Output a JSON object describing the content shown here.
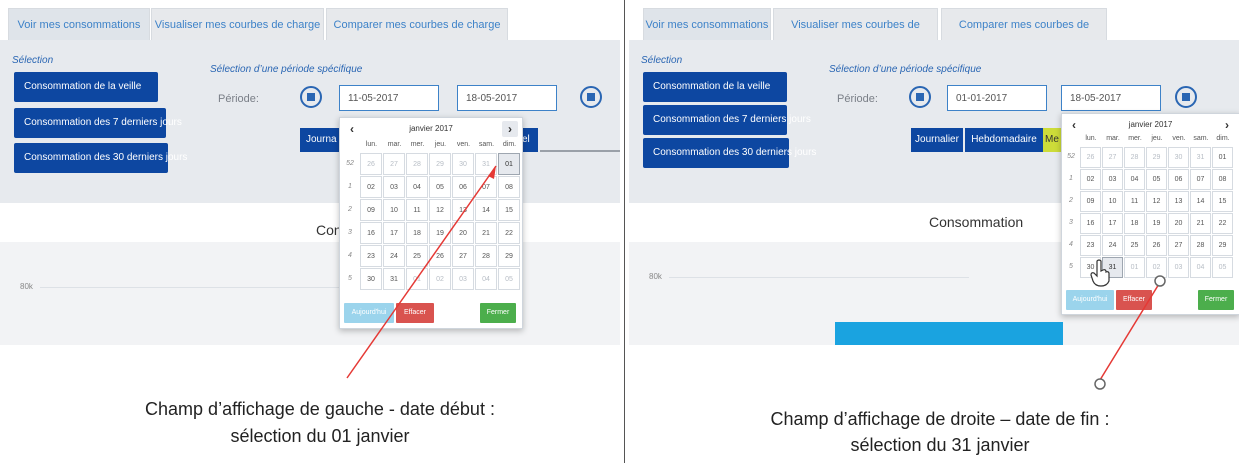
{
  "tabs": [
    {
      "label": "Voir mes consommations"
    },
    {
      "label": "Visualiser mes courbes de charge"
    },
    {
      "label": "Comparer mes courbes de charge"
    }
  ],
  "selection": {
    "title": "Sélection",
    "buttons": [
      "Consommation de la veille",
      "Consommation des 7 derniers jours",
      "Consommation des 30 derniers jours"
    ]
  },
  "specific": {
    "title": "Sélection d’une période spécifique",
    "periode_label": "Période:"
  },
  "left": {
    "start_date": "11-05-2017",
    "end_date": "18-05-2017",
    "period_visible": "Journa",
    "period_visible_right": "el",
    "cons_title": "Con",
    "yaxis": "80k"
  },
  "right": {
    "start_date": "01-01-2017",
    "end_date": "18-05-2017",
    "period_buttons": [
      "Journalier",
      "Hebdomadaire",
      "Me"
    ],
    "cons_title": "Consommation",
    "yaxis": "80k"
  },
  "datepicker": {
    "month_title": "janvier 2017",
    "prev": "‹",
    "next": "›",
    "days": [
      "lun.",
      "mar.",
      "mer.",
      "jeu.",
      "ven.",
      "sam.",
      "dim."
    ],
    "weeks": [
      "52",
      "1",
      "2",
      "3",
      "4",
      "5"
    ],
    "rows": [
      [
        "26",
        "27",
        "28",
        "29",
        "30",
        "31",
        "01"
      ],
      [
        "02",
        "03",
        "04",
        "05",
        "06",
        "07",
        "08"
      ],
      [
        "09",
        "10",
        "11",
        "12",
        "13",
        "14",
        "15"
      ],
      [
        "16",
        "17",
        "18",
        "19",
        "20",
        "21",
        "22"
      ],
      [
        "23",
        "24",
        "25",
        "26",
        "27",
        "28",
        "29"
      ],
      [
        "30",
        "31",
        "01",
        "02",
        "03",
        "04",
        "05"
      ]
    ],
    "today": "Aujourd'hui",
    "clear": "Effacer",
    "close": "Fermer"
  },
  "captions": {
    "left_line1": "Champ d’affichage de gauche - date début :",
    "left_line2": "sélection du 01 janvier",
    "right_line1": "Champ d’affichage de droite – date de fin :",
    "right_line2": "sélection du 31 janvier"
  },
  "colors": {
    "nav_blue": "#0d47a1",
    "link_blue": "#3d82c8",
    "arrow_red": "#e53935",
    "clear_red": "#d9534f",
    "close_green": "#4cae4c",
    "today_blue": "#9bd4ec",
    "bar_cyan": "#1aa3e0"
  }
}
